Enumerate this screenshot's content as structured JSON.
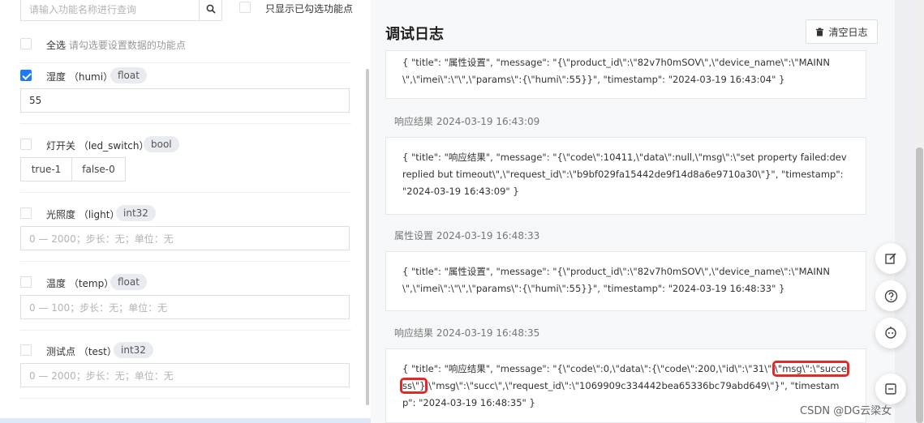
{
  "filter": {
    "search_placeholder": "请输入功能名称进行查询",
    "only_selected_label": "只显示已勾选功能点",
    "select_all_label": "全选",
    "select_all_hint": "请勾选要设置数据的功能点"
  },
  "properties": [
    {
      "name": "湿度",
      "id": "（humi）",
      "type": "float",
      "checked": true,
      "input_value": "55"
    },
    {
      "name": "灯开关",
      "id": "（led_switch）",
      "type": "bool",
      "checked": false,
      "options": [
        "true-1",
        "false-0"
      ]
    },
    {
      "name": "光照度",
      "id": "（light）",
      "type": "int32",
      "checked": false,
      "placeholder": "0 — 2000；步长：无；单位：无"
    },
    {
      "name": "温度",
      "id": "（temp）",
      "type": "float",
      "checked": false,
      "placeholder": "0 — 100；步长：无；单位：无"
    },
    {
      "name": "测试点",
      "id": "（test）",
      "type": "int32",
      "checked": false,
      "placeholder": "0 — 2000；步长：无；单位：无"
    }
  ],
  "log": {
    "title": "调试日志",
    "clear_label": "清空日志",
    "entries": [
      {
        "heading": "",
        "body": "{ \"title\": \"属性设置\", \"message\": \"{\\\"product_id\\\":\\\"82v7h0mSOV\\\",\\\"device_name\\\":\\\"MAINN\\\",\\\"imei\\\":\\\"\\\",\\\"params\\\":{\\\"humi\\\":55}}\", \"timestamp\": \"2024-03-19 16:43:04\" }"
      },
      {
        "heading": "响应结果 2024-03-19 16:43:09",
        "body": "{ \"title\": \"响应结果\", \"message\": \"{\\\"code\\\":10411,\\\"data\\\":null,\\\"msg\\\":\\\"set property failed:dev replied but timeout\\\",\\\"request_id\\\":\\\"b9bf029fa15442de9f14d8a6e9710a30\\\"}\", \"timestamp\": \"2024-03-19 16:43:09\" }"
      },
      {
        "heading": "属性设置 2024-03-19 16:48:33",
        "body": "{ \"title\": \"属性设置\", \"message\": \"{\\\"product_id\\\":\\\"82v7h0mSOV\\\",\\\"device_name\\\":\\\"MAINN\\\",\\\"imei\\\":\\\"\\\",\\\"params\\\":{\\\"humi\\\":55}}\", \"timestamp\": \"2024-03-19 16:48:33\" }"
      },
      {
        "heading": "响应结果 2024-03-19 16:48:35",
        "body_pre": "{ \"title\": \"响应结果\", \"message\": \"{\\\"code\\\":0,\\\"data\\\":{\\\"code\\\":200,\\\"id\\\":\\\"31\\\",",
        "body_highlight": "\\\"msg\\\":\\\"success\\\"}",
        "body_post": ",\\\"msg\\\":\\\"succ\\\",\\\"request_id\\\":\\\"1069909c334442bea65336bc79abd649\\\"}\", \"timestamp\": \"2024-03-19 16:48:35\" }"
      }
    ]
  },
  "float_buttons": [
    "edit-icon",
    "help-icon",
    "robot-icon",
    "minimize-icon"
  ],
  "watermark": "CSDN @DG云梁女",
  "colors": {
    "accent": "#1f7bf5",
    "highlight_border": "#e02b2b"
  }
}
